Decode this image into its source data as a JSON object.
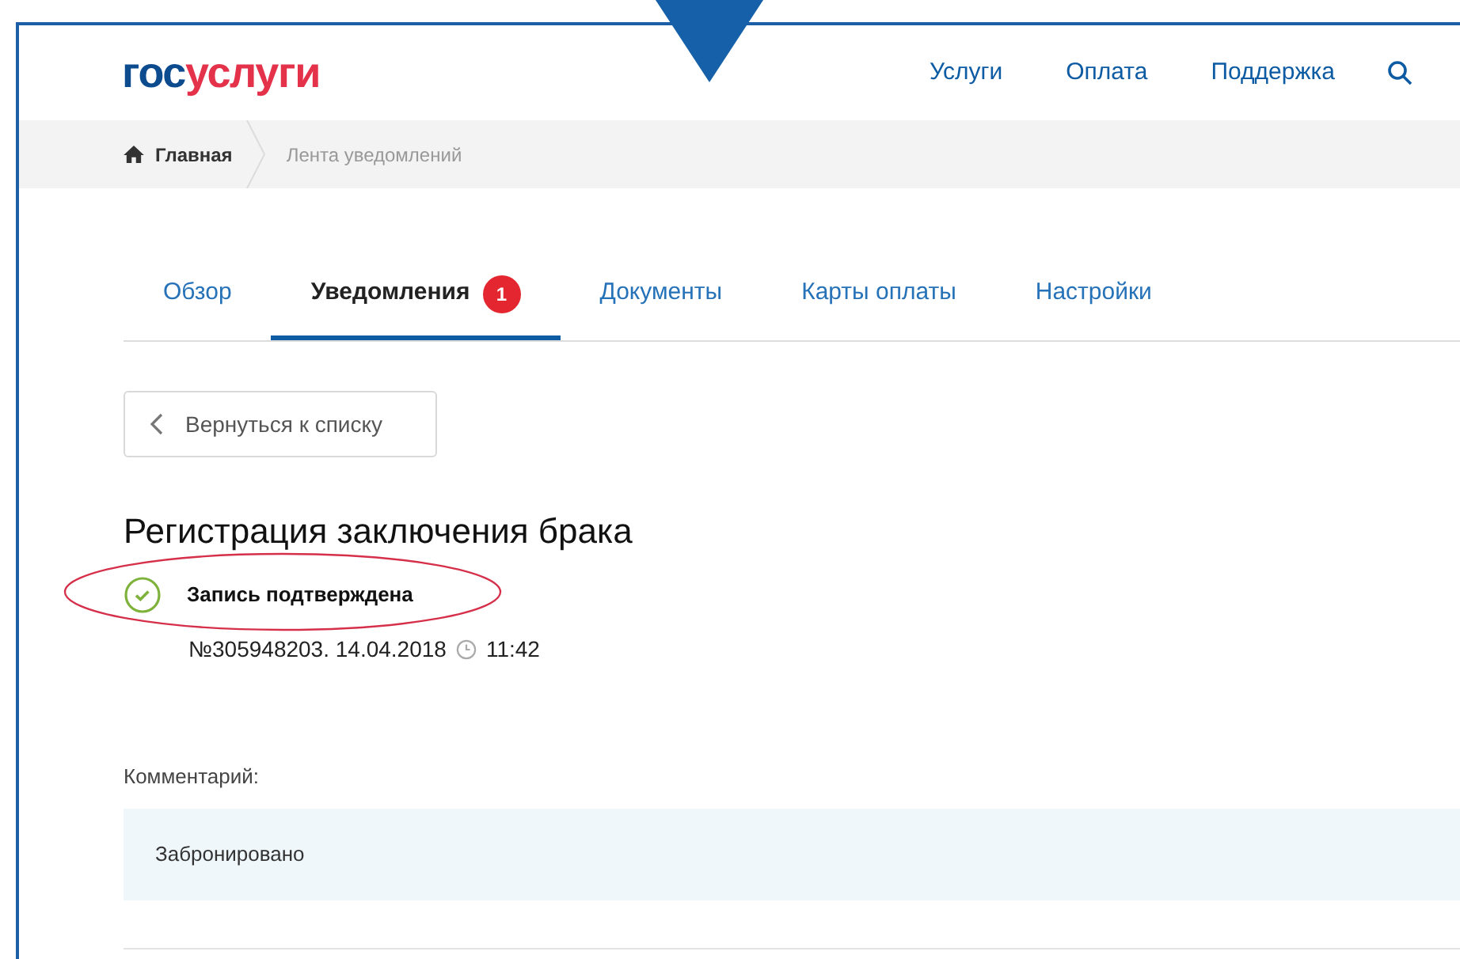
{
  "header": {
    "logo": [
      {
        "text": "гос",
        "color": "#0d4b8f"
      },
      {
        "text": "услуги",
        "color": "#e3324a"
      }
    ],
    "nav": [
      {
        "label": "Услуги"
      },
      {
        "label": "Оплата"
      },
      {
        "label": "Поддержка"
      }
    ]
  },
  "breadcrumbs": [
    {
      "label": "Главная",
      "kind": "home"
    },
    {
      "label": "Лента уведомлений",
      "kind": "current"
    }
  ],
  "tabs": [
    {
      "label": "Обзор",
      "selected": false
    },
    {
      "label": "Уведомления",
      "selected": true,
      "badge": "1"
    },
    {
      "label": "Документы",
      "selected": false
    },
    {
      "label": "Карты оплаты",
      "selected": false
    },
    {
      "label": "Настройки",
      "selected": false
    }
  ],
  "back_button": "Вернуться к списку",
  "notification": {
    "title": "Регистрация заключения брака",
    "status": "Запись подтверждена",
    "number_date": "№305948203. 14.04.2018",
    "time": "11:42"
  },
  "comment": {
    "label": "Комментарий:",
    "text": "Забронировано"
  }
}
